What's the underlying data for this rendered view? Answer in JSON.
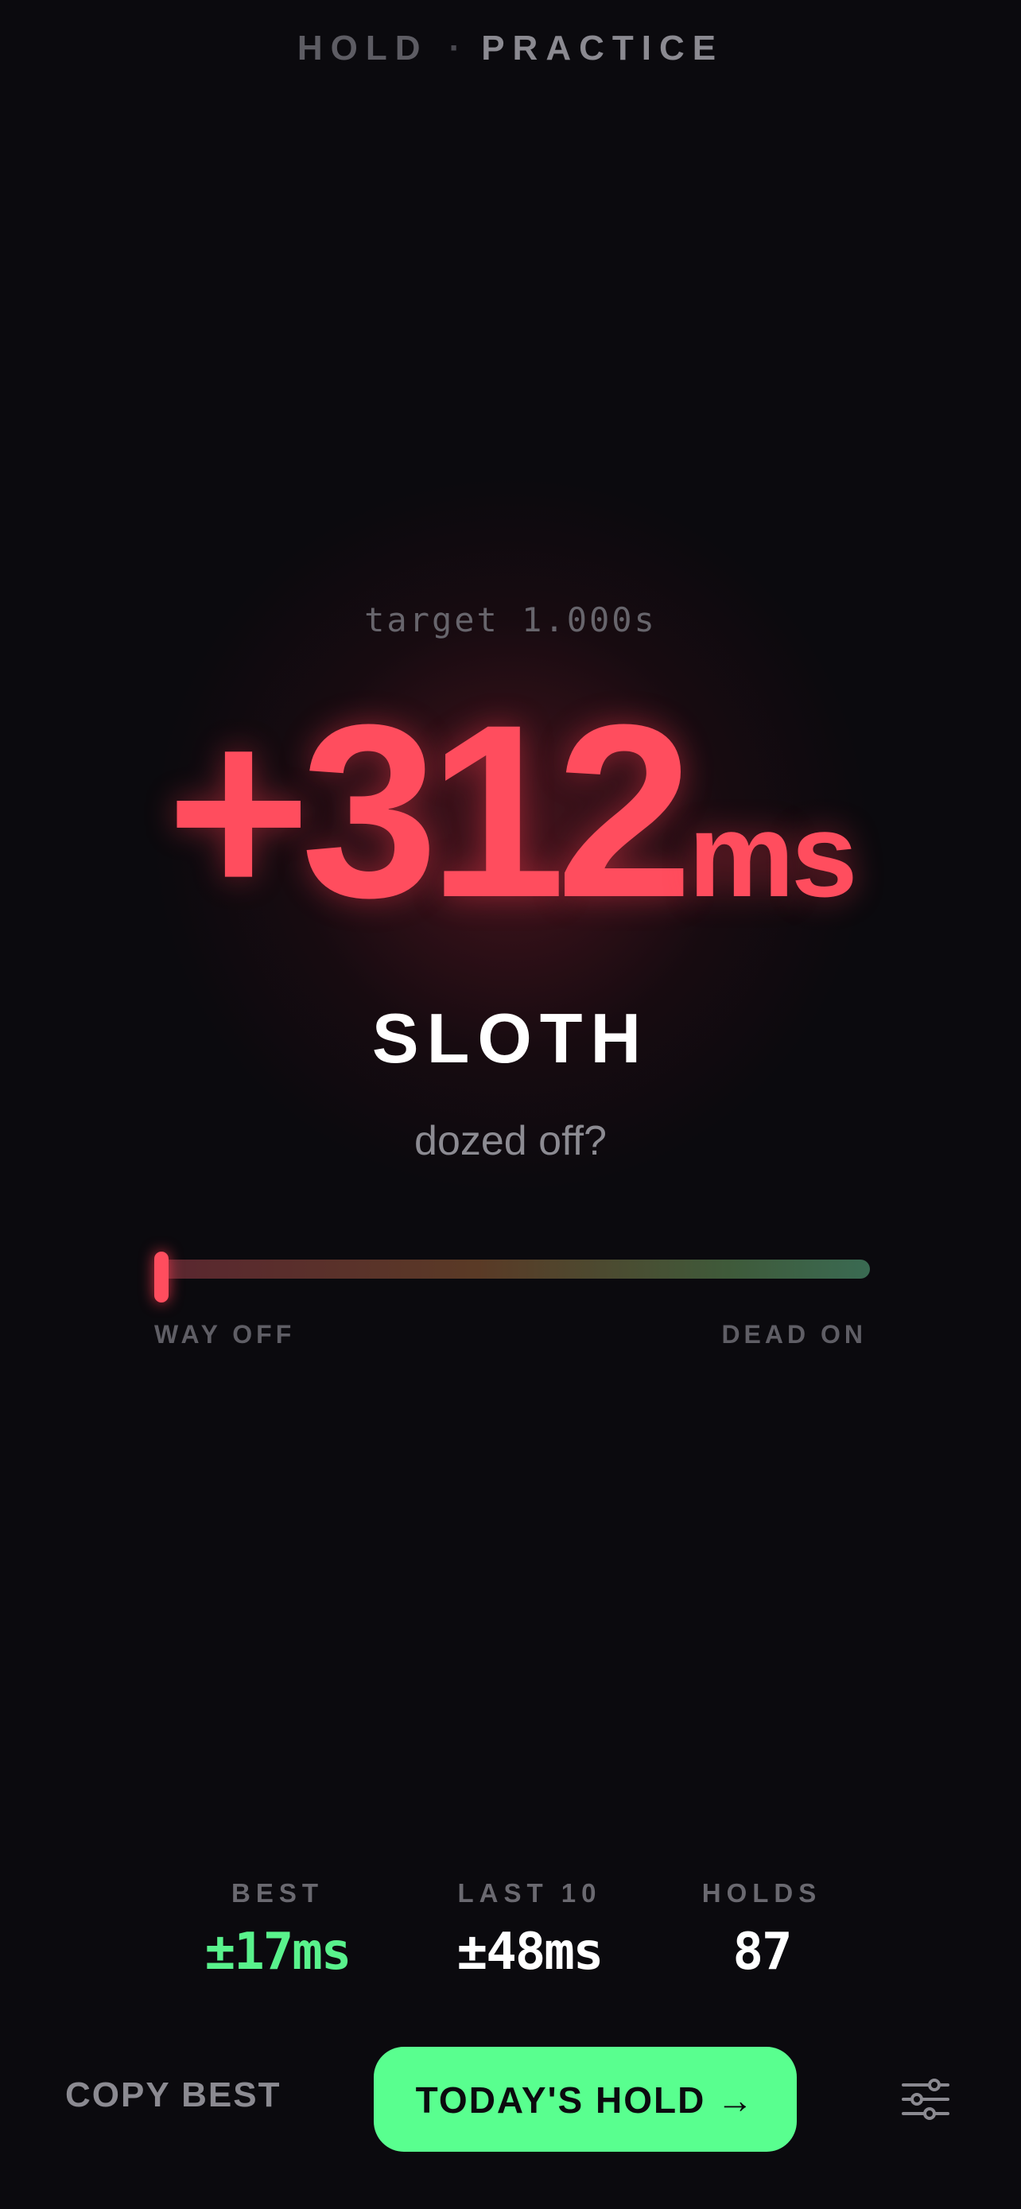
{
  "header": {
    "mode_1": "HOLD",
    "separator": "·",
    "mode_2": "PRACTICE"
  },
  "result": {
    "target": "target 1.000s",
    "delta": "+312",
    "unit": "ms",
    "rank": "SLOTH",
    "quip": "dozed off?"
  },
  "meter": {
    "left_label": "WAY OFF",
    "right_label": "DEAD ON",
    "accuracy_fraction": 0.0
  },
  "stats": {
    "best": {
      "label": "BEST",
      "value": "±17ms"
    },
    "last10": {
      "label": "LAST 10",
      "value": "±48ms"
    },
    "holds": {
      "label": "HOLDS",
      "value": "87"
    }
  },
  "actions": {
    "copy_best": "COPY BEST",
    "todays_hold": "TODAY'S HOLD",
    "todays_hold_arrow": "→",
    "settings_icon": "sliders-icon"
  },
  "colors": {
    "background": "#0b0a0e",
    "result_red": "#ff4d5e",
    "best_green": "#59f28c",
    "primary_green": "#59ff8f"
  }
}
